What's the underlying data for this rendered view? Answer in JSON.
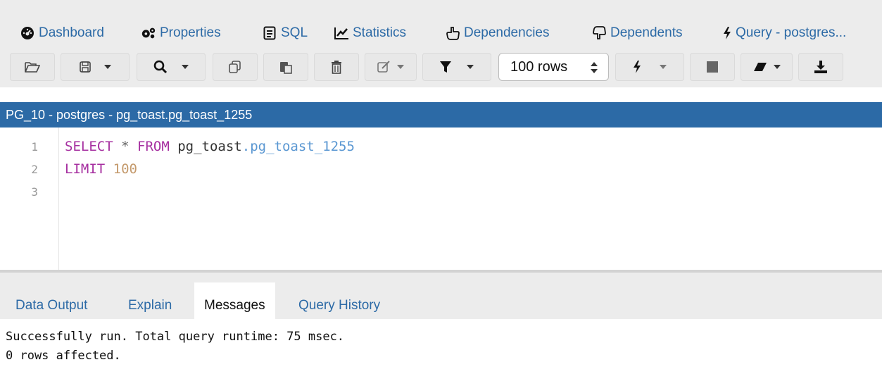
{
  "top_tabs": [
    {
      "label": "Dashboard",
      "icon": "dashboard-icon"
    },
    {
      "label": "Properties",
      "icon": "gears-icon"
    },
    {
      "label": "SQL",
      "icon": "file-text-icon"
    },
    {
      "label": "Statistics",
      "icon": "line-chart-icon"
    },
    {
      "label": "Dependencies",
      "icon": "hand-up-icon"
    },
    {
      "label": "Dependents",
      "icon": "hand-down-icon"
    },
    {
      "label": "Query - postgres...",
      "icon": "bolt-icon"
    }
  ],
  "toolbar": {
    "rows_limit": "100 rows"
  },
  "panel": {
    "title": "PG_10 - postgres - pg_toast.pg_toast_1255"
  },
  "editor": {
    "line_numbers": [
      "1",
      "2",
      "3"
    ],
    "line1": {
      "kw1": "SELECT",
      "star": "*",
      "kw2": "FROM",
      "schema": "pg_toast",
      "dot": ".",
      "table": "pg_toast_1255"
    },
    "line2": {
      "kw": "LIMIT",
      "num": "100"
    }
  },
  "bottom_tabs": [
    "Data Output",
    "Explain",
    "Messages",
    "Query History"
  ],
  "active_bottom_tab": "Messages",
  "messages": {
    "line1": "Successfully run. Total query runtime: 75 msec.",
    "line2": "0 rows affected."
  },
  "colors": {
    "link": "#2c6aa6",
    "header_bg": "#2c6aa6",
    "keyword": "#a62fa0",
    "field": "#5a97d2",
    "number": "#c49a6c"
  }
}
